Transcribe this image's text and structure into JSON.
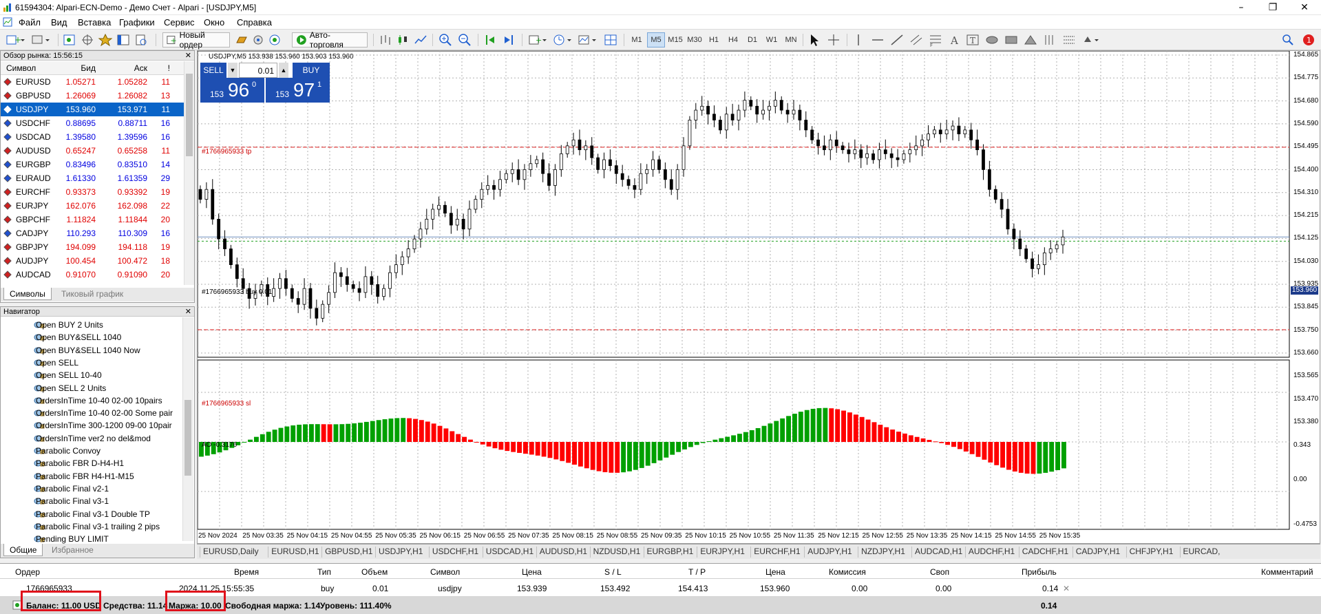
{
  "window": {
    "title": "61594304: Alpari-ECN-Demo - Демо Счет - Alpari - [USDJPY,M5]"
  },
  "menu": [
    "Файл",
    "Вид",
    "Вставка",
    "Графики",
    "Сервис",
    "Окно",
    "Справка"
  ],
  "toolbar": {
    "new_order": "Новый ордер",
    "autotrading": "Авто-торговля",
    "timeframes": [
      "M1",
      "M5",
      "M15",
      "M30",
      "H1",
      "H4",
      "D1",
      "W1",
      "MN"
    ],
    "active_timeframe": "M5",
    "notifications": "1"
  },
  "market_watch": {
    "title": "Обзор рынка: 15:56:15",
    "columns": [
      "Символ",
      "Бид",
      "Аск",
      "!"
    ],
    "rows": [
      {
        "symbol": "EURUSD",
        "bid": "1.05271",
        "ask": "1.05282",
        "spread": "11",
        "color": "red"
      },
      {
        "symbol": "GBPUSD",
        "bid": "1.26069",
        "ask": "1.26082",
        "spread": "13",
        "color": "red"
      },
      {
        "symbol": "USDJPY",
        "bid": "153.960",
        "ask": "153.971",
        "spread": "11",
        "color": "sel"
      },
      {
        "symbol": "USDCHF",
        "bid": "0.88695",
        "ask": "0.88711",
        "spread": "16",
        "color": "blue"
      },
      {
        "symbol": "USDCAD",
        "bid": "1.39580",
        "ask": "1.39596",
        "spread": "16",
        "color": "blue"
      },
      {
        "symbol": "AUDUSD",
        "bid": "0.65247",
        "ask": "0.65258",
        "spread": "11",
        "color": "red"
      },
      {
        "symbol": "EURGBP",
        "bid": "0.83496",
        "ask": "0.83510",
        "spread": "14",
        "color": "blue"
      },
      {
        "symbol": "EURAUD",
        "bid": "1.61330",
        "ask": "1.61359",
        "spread": "29",
        "color": "blue"
      },
      {
        "symbol": "EURCHF",
        "bid": "0.93373",
        "ask": "0.93392",
        "spread": "19",
        "color": "red"
      },
      {
        "symbol": "EURJPY",
        "bid": "162.076",
        "ask": "162.098",
        "spread": "22",
        "color": "red"
      },
      {
        "symbol": "GBPCHF",
        "bid": "1.11824",
        "ask": "1.11844",
        "spread": "20",
        "color": "red"
      },
      {
        "symbol": "CADJPY",
        "bid": "110.293",
        "ask": "110.309",
        "spread": "16",
        "color": "blue"
      },
      {
        "symbol": "GBPJPY",
        "bid": "194.099",
        "ask": "194.118",
        "spread": "19",
        "color": "red"
      },
      {
        "symbol": "AUDJPY",
        "bid": "100.454",
        "ask": "100.472",
        "spread": "18",
        "color": "red"
      },
      {
        "symbol": "AUDCAD",
        "bid": "0.91070",
        "ask": "0.91090",
        "spread": "20",
        "color": "red"
      }
    ],
    "tabs": [
      "Символы",
      "Тиковый график"
    ]
  },
  "navigator": {
    "title": "Навигатор",
    "items": [
      "Open BUY 2 Units",
      "Open BUY&SELL 1040",
      "Open BUY&SELL 1040 Now",
      "Open SELL",
      "Open SELL 10-40",
      "Open SELL 2 Units",
      "OrdersInTime 10-40 02-00 10pairs",
      "OrdersInTime 10-40 02-00 Some pair",
      "OrdersInTime 300-1200 09-00 10pair",
      "OrdersInTime ver2 no del&mod",
      "Parabolic Convoy",
      "Parabolic FBR D-H4-H1",
      "Parabolic FBR H4-H1-M15",
      "Parabolic Final v2-1",
      "Parabolic Final v3-1",
      "Parabolic Final v3-1 Double TP",
      "Parabolic Final v3-1 trailing 2 pips",
      "Pending BUY LIMIT"
    ],
    "tabs": [
      "Общие",
      "Избранное"
    ]
  },
  "chart": {
    "header": "USDJPY,M5  153.938 153.960 153.903 153.960",
    "trade_panel": {
      "sell": "SELL",
      "buy": "BUY",
      "volume": "0.01",
      "sell_price_big": "153",
      "sell_price_pips": "96",
      "sell_price_frac": "0",
      "buy_price_big": "153",
      "buy_price_pips": "97",
      "buy_price_frac": "1"
    },
    "lines": {
      "tp": "#1766965933 tp",
      "buy": "#1766965933 buy 0.01",
      "sl": "#1766965933 sl"
    },
    "current_price": "153.960",
    "ao_label": "AO -0.3176",
    "price_axis": [
      "154.865",
      "154.775",
      "154.680",
      "154.590",
      "154.495",
      "154.400",
      "154.310",
      "154.215",
      "154.125",
      "154.030",
      "153.935",
      "153.845",
      "153.750",
      "153.660",
      "153.565",
      "153.470",
      "153.380"
    ],
    "ao_axis": [
      "0.343",
      "0.00",
      "-0.4753"
    ],
    "time_axis": [
      "25 Nov 2024",
      "25 Nov 03:35",
      "25 Nov 04:15",
      "25 Nov 04:55",
      "25 Nov 05:35",
      "25 Nov 06:15",
      "25 Nov 06:55",
      "25 Nov 07:35",
      "25 Nov 08:15",
      "25 Nov 08:55",
      "25 Nov 09:35",
      "25 Nov 10:15",
      "25 Nov 10:55",
      "25 Nov 11:35",
      "25 Nov 12:15",
      "25 Nov 12:55",
      "25 Nov 13:35",
      "25 Nov 14:15",
      "25 Nov 14:55",
      "25 Nov 15:35"
    ]
  },
  "chart_tabs": [
    "EURUSD,Daily",
    "EURUSD,H1",
    "GBPUSD,H1",
    "USDJPY,H1",
    "USDCHF,H1",
    "USDCAD,H1",
    "AUDUSD,H1",
    "NZDUSD,H1",
    "EURGBP,H1",
    "EURJPY,H1",
    "EURCHF,H1",
    "AUDJPY,H1",
    "NZDJPY,H1",
    "AUDCAD,H1",
    "AUDCHF,H1",
    "CADCHF,H1",
    "CADJPY,H1",
    "CHFJPY,H1",
    "EURCAD,"
  ],
  "terminal": {
    "columns": [
      "Ордер",
      "Время",
      "Тип",
      "Объем",
      "Символ",
      "Цена",
      "S / L",
      "T / P",
      "Цена",
      "Комиссия",
      "Своп",
      "Прибыль",
      "Комментарий"
    ],
    "order": {
      "id": "1766965933",
      "time": "2024.11.25 15:55:35",
      "type": "buy",
      "volume": "0.01",
      "symbol": "usdjpy",
      "price": "153.939",
      "sl": "153.492",
      "tp": "154.413",
      "cur_price": "153.960",
      "commission": "0.00",
      "swap": "0.00",
      "profit": "0.14"
    },
    "status": {
      "balance": "Баланс: 11.00 USD",
      "equity": "Средства: 11.14",
      "margin": "Маржа: 10.00",
      "free_margin": "Свободная маржа: 1.14",
      "level": "Уровень: 111.40%",
      "total": "0.14"
    }
  },
  "colors": {
    "bull": "#00a000",
    "bear": "#ff0000",
    "selection": "#0a64c8",
    "trade_panel": "#1e4fb2",
    "highlight": "#e0101a"
  }
}
